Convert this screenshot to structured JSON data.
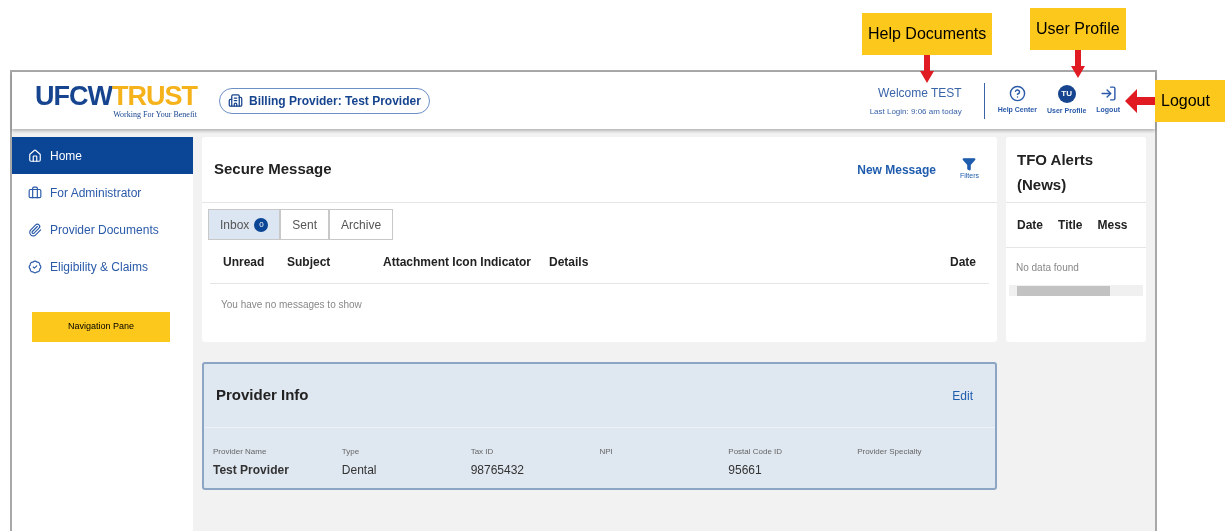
{
  "annotations": [
    {
      "kind": "down",
      "label": "Help Documents"
    },
    {
      "kind": "down",
      "label": "User Profile"
    },
    {
      "kind": "left",
      "label": "Logout"
    }
  ],
  "header": {
    "logo": {
      "part_1": "UFCW",
      "part_2": "TRUST",
      "tagline": "Working For Your Benefit"
    },
    "billing_provider": "Billing Provider: Test Provider",
    "welcome": "Welcome TEST",
    "last_login": "Last Login: 9:06 am today",
    "actions": [
      {
        "label": "Help Center"
      },
      {
        "label": "User Profile",
        "avatar": "TU"
      },
      {
        "label": "Logout"
      }
    ]
  },
  "sidebar": {
    "items": [
      {
        "label": "Home",
        "selected": true
      },
      {
        "label": "For Administrator",
        "selected": false
      },
      {
        "label": "Provider Documents",
        "selected": false
      },
      {
        "label": "Eligibility & Claims",
        "selected": false
      }
    ],
    "note": "Navigation Pane"
  },
  "secure_message": {
    "title": "Secure Message",
    "new_message": "New Message",
    "filters": "Filters",
    "tabs": [
      {
        "label": "Inbox",
        "count": "0",
        "selected": true
      },
      {
        "label": "Sent",
        "selected": false
      },
      {
        "label": "Archive",
        "selected": false
      }
    ],
    "columns": [
      "Unread",
      "Subject",
      "Attachment Icon Indicator",
      "Details",
      "Date"
    ],
    "empty": "You have no messages to show"
  },
  "alerts": {
    "title": "TFO Alerts (News)",
    "columns": [
      "Date",
      "Title",
      "Mess"
    ],
    "empty": "No data found"
  },
  "provider_info": {
    "title": "Provider Info",
    "edit": "Edit",
    "fields": [
      {
        "label": "Provider Name",
        "value": "Test Provider"
      },
      {
        "label": "Type",
        "value": "Dental"
      },
      {
        "label": "Tax ID",
        "value": "98765432"
      },
      {
        "label": "NPI"
      },
      {
        "label": "Postal Code ID",
        "value": "95661"
      },
      {
        "label": "Provider Specialty"
      }
    ]
  }
}
